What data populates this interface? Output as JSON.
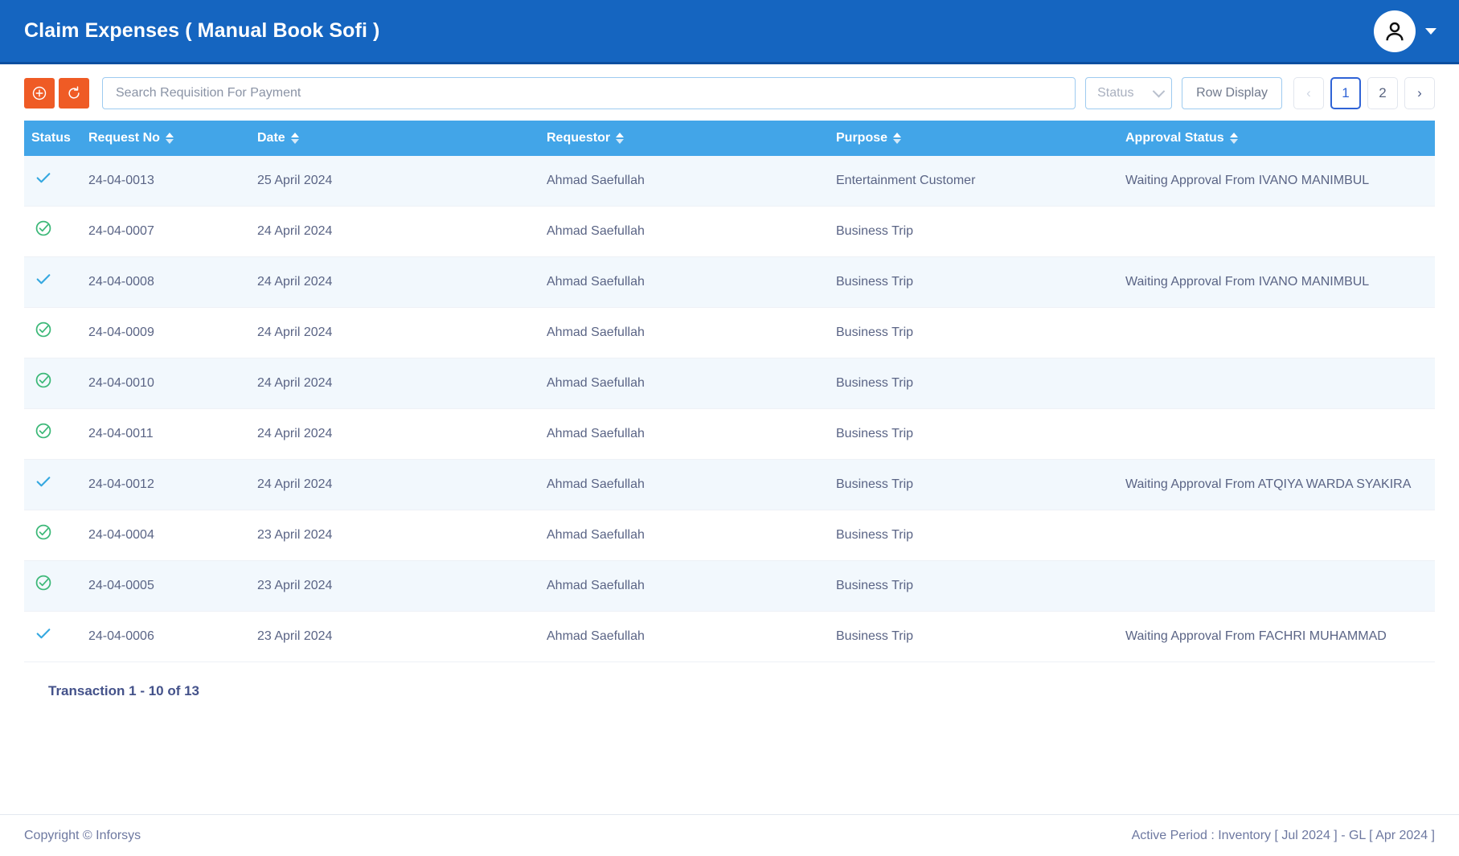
{
  "header": {
    "title": "Claim Expenses ( Manual Book Sofi )",
    "avatar_icon": "user-icon",
    "caret_icon": "caret-down-icon"
  },
  "toolbar": {
    "add_icon": "plus-circle-icon",
    "refresh_icon": "refresh-icon",
    "search_placeholder": "Search Requisition For Payment",
    "search_value": "",
    "status_filter_label": "Status",
    "status_chevron_icon": "chevron-down-icon",
    "row_display_label": "Row Display",
    "pagination": {
      "prev_label": "‹",
      "next_label": "›",
      "pages": [
        "1",
        "2"
      ],
      "active_page": "1"
    }
  },
  "table": {
    "columns": [
      {
        "key": "status",
        "label": "Status",
        "sortable": false
      },
      {
        "key": "request_no",
        "label": "Request No",
        "sortable": true
      },
      {
        "key": "date",
        "label": "Date",
        "sortable": true
      },
      {
        "key": "requestor",
        "label": "Requestor",
        "sortable": true
      },
      {
        "key": "purpose",
        "label": "Purpose",
        "sortable": true
      },
      {
        "key": "approval_status",
        "label": "Approval Status",
        "sortable": true
      }
    ],
    "rows": [
      {
        "status_icon": "check-icon",
        "request_no": "24-04-0013",
        "date": "25 April 2024",
        "requestor": "Ahmad Saefullah",
        "purpose": "Entertainment Customer",
        "approval_status": "Waiting Approval From IVANO MANIMBUL"
      },
      {
        "status_icon": "check-circle-icon",
        "request_no": "24-04-0007",
        "date": "24 April 2024",
        "requestor": "Ahmad Saefullah",
        "purpose": "Business Trip",
        "approval_status": ""
      },
      {
        "status_icon": "check-icon",
        "request_no": "24-04-0008",
        "date": "24 April 2024",
        "requestor": "Ahmad Saefullah",
        "purpose": "Business Trip",
        "approval_status": "Waiting Approval From IVANO MANIMBUL"
      },
      {
        "status_icon": "check-circle-icon",
        "request_no": "24-04-0009",
        "date": "24 April 2024",
        "requestor": "Ahmad Saefullah",
        "purpose": "Business Trip",
        "approval_status": ""
      },
      {
        "status_icon": "check-circle-icon",
        "request_no": "24-04-0010",
        "date": "24 April 2024",
        "requestor": "Ahmad Saefullah",
        "purpose": "Business Trip",
        "approval_status": ""
      },
      {
        "status_icon": "check-circle-icon",
        "request_no": "24-04-0011",
        "date": "24 April 2024",
        "requestor": "Ahmad Saefullah",
        "purpose": "Business Trip",
        "approval_status": ""
      },
      {
        "status_icon": "check-icon",
        "request_no": "24-04-0012",
        "date": "24 April 2024",
        "requestor": "Ahmad Saefullah",
        "purpose": "Business Trip",
        "approval_status": "Waiting Approval From ATQIYA WARDA SYAKIRA"
      },
      {
        "status_icon": "check-circle-icon",
        "request_no": "24-04-0004",
        "date": "23 April 2024",
        "requestor": "Ahmad Saefullah",
        "purpose": "Business Trip",
        "approval_status": ""
      },
      {
        "status_icon": "check-circle-icon",
        "request_no": "24-04-0005",
        "date": "23 April 2024",
        "requestor": "Ahmad Saefullah",
        "purpose": "Business Trip",
        "approval_status": ""
      },
      {
        "status_icon": "check-icon",
        "request_no": "24-04-0006",
        "date": "23 April 2024",
        "requestor": "Ahmad Saefullah",
        "purpose": "Business Trip",
        "approval_status": "Waiting Approval From FACHRI MUHAMMAD"
      }
    ],
    "transaction_count": "Transaction 1 - 10 of 13"
  },
  "footer": {
    "copyright": "Copyright © Inforsys",
    "active_period": "Active Period  :  Inventory [ Jul 2024 ]  -  GL [ Apr 2024 ]"
  },
  "colors": {
    "header_blue": "#1565C0",
    "table_header_blue": "#42A5E8",
    "accent_orange": "#EF5B25",
    "row_stripe": "#F2F8FD",
    "check_blue": "#35A8E0",
    "check_green": "#3CB878",
    "text_indigo": "#5a6485"
  }
}
